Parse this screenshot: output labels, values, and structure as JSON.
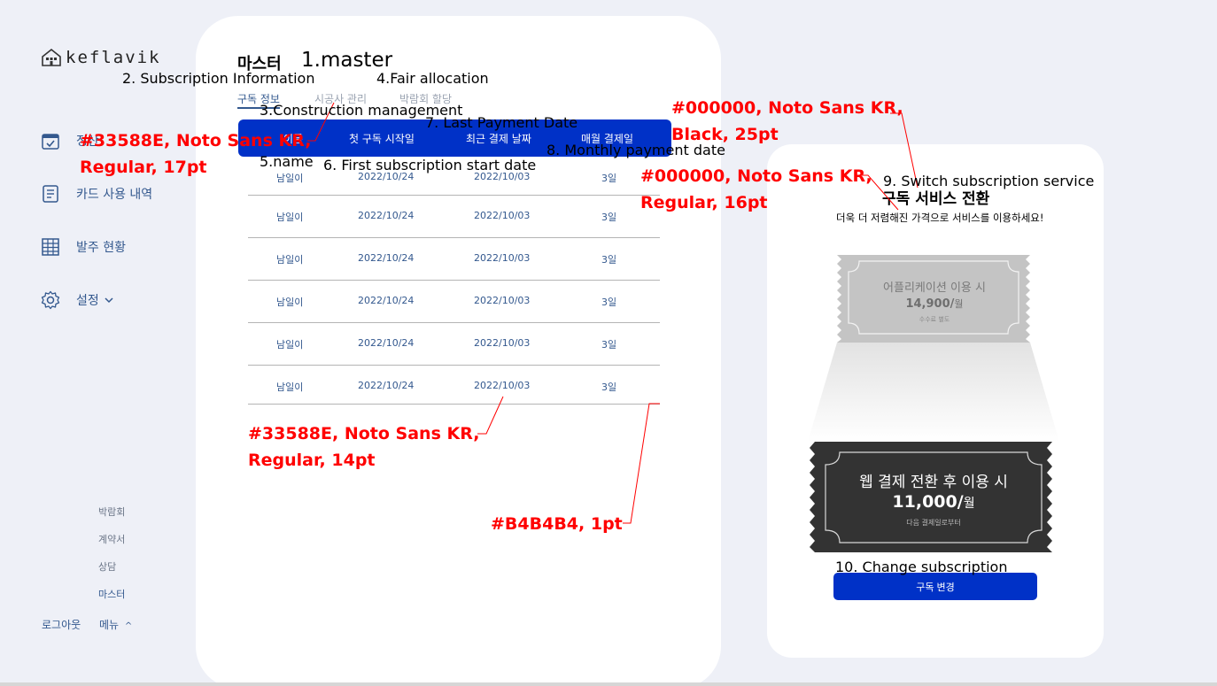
{
  "sidebar": {
    "logo_text": "keflavik",
    "nav_items": [
      {
        "icon": "calendar-check-icon",
        "label": "정산"
      },
      {
        "icon": "receipt-list-icon",
        "label": "카드 사용 내역"
      },
      {
        "icon": "spreadsheet-grid-icon",
        "label": "발주 현황"
      },
      {
        "icon": "gear-icon",
        "label": "설정",
        "chevron": "chevron-down-icon"
      }
    ],
    "sub_menu": [
      "박람회",
      "계약서",
      "상담",
      "마스터"
    ],
    "logout_label": "로그아웃",
    "menu_label": "메뉴",
    "menu_chevron": "^"
  },
  "main": {
    "title": "마스터",
    "tabs": [
      "구독 정보",
      "시공사 관리",
      "박람회 할당"
    ],
    "table": {
      "headers": [
        "이름",
        "첫 구독 시작일",
        "최근 결제 날짜",
        "매월 결제일"
      ],
      "rows": [
        [
          "남일이",
          "2022/10/24",
          "2022/10/03",
          "3일"
        ],
        [
          "남일이",
          "2022/10/24",
          "2022/10/03",
          "3일"
        ],
        [
          "남일이",
          "2022/10/24",
          "2022/10/03",
          "3일"
        ],
        [
          "남일이",
          "2022/10/24",
          "2022/10/03",
          "3일"
        ],
        [
          "남일이",
          "2022/10/24",
          "2022/10/03",
          "3일"
        ],
        [
          "남일이",
          "2022/10/24",
          "2022/10/03",
          "3일"
        ]
      ]
    }
  },
  "subscription": {
    "title": "구독 서비스 전환",
    "subtitle": "더욱 더 저렴해진 가격으로 서비스를 이용하세요!",
    "app_ticket": {
      "label": "어플리케이션 이용 시",
      "price": "14,900/",
      "unit": "월",
      "note": "수수료 별도"
    },
    "web_ticket": {
      "label": "웹 결제 전환 후 이용 시",
      "price": "11,000/",
      "unit": "월",
      "note": "다음 결제일로부터"
    },
    "change_button": "구독 변경"
  },
  "annotations": {
    "master": "1.master",
    "subscription_info": "2. Subscription Information",
    "construction": "3.Construction management",
    "fair": "4.Fair allocation",
    "name": "5.name",
    "first_start": "6. First subscription start date",
    "last_payment": "7. Last Payment Date",
    "monthly_payment": "8. Monthly payment date",
    "switch_service": "9. Switch subscription service",
    "change_sub": "10. Change subscription",
    "spec_nav_1": "#33588E, Noto Sans KR,",
    "spec_nav_2": "Regular, 17pt",
    "spec_black_1": "#000000, Noto Sans KR,",
    "spec_black_2": "Black, 25pt",
    "spec_regular16_1": "#000000, Noto Sans KR,",
    "spec_regular16_2": "Regular, 16pt",
    "spec_table_1": "#33588E, Noto Sans KR,",
    "spec_table_2": "Regular, 14pt",
    "spec_line": "#B4B4B4, 1pt"
  },
  "colors": {
    "primary": "#0031c7",
    "text_blue": "#33588E",
    "divider": "#B4B4B4",
    "annotation": "#ff0000"
  }
}
